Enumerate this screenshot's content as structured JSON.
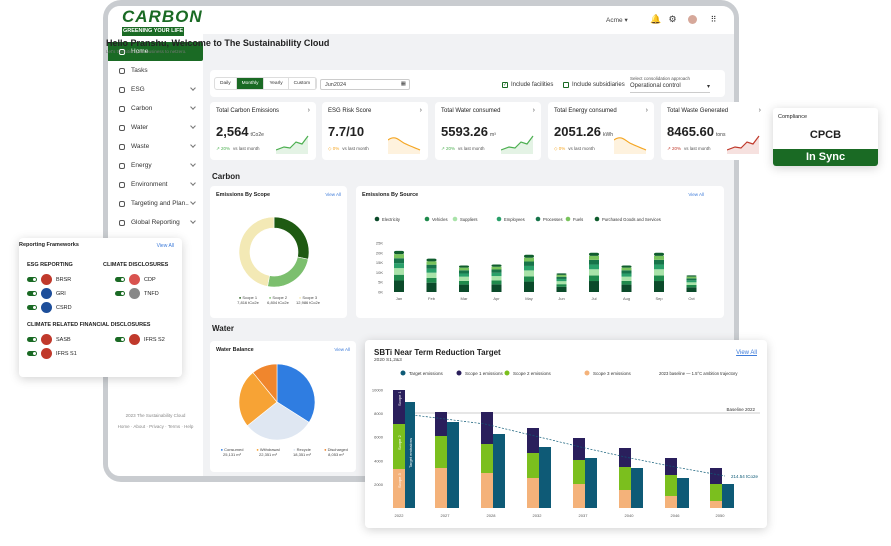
{
  "brand": {
    "logo_word": "CARBON",
    "logo_tagline": "GREENING YOUR LIFE"
  },
  "sidebar": {
    "items": [
      {
        "label": "Home",
        "active": true
      },
      {
        "label": "Tasks"
      },
      {
        "label": "ESG",
        "chevron": true
      },
      {
        "label": "Carbon",
        "chevron": true
      },
      {
        "label": "Water",
        "chevron": true
      },
      {
        "label": "Waste",
        "chevron": true
      },
      {
        "label": "Energy",
        "chevron": true
      },
      {
        "label": "Environment",
        "chevron": true
      },
      {
        "label": "Targeting and Plan..",
        "chevron": true
      },
      {
        "label": "Global Reporting",
        "chevron": true
      }
    ],
    "footer_copyright": "2023 The Sustainability Cloud",
    "footer_links": "Home · About · Privacy · Terms · Help"
  },
  "topbar": {
    "org": "Acme"
  },
  "welcome": {
    "title": "Hello Pranshu, Welcome to The Sustainability Cloud",
    "subtitle": "Let's transition your business to netzero."
  },
  "filters": {
    "periods": [
      "Daily",
      "Monthly",
      "Yearly",
      "Custom"
    ],
    "active_period": "Monthly",
    "date": "Jun2024",
    "include_facilities": "Include facilities",
    "include_subsidiaries": "Include subsidiaries",
    "consolidation_label": "Select consolidation approach",
    "consolidation_value": "Operational control"
  },
  "kpis": [
    {
      "title": "Total Carbon Emissions",
      "value": "2,564",
      "unit": "tCo2e",
      "delta": "20%",
      "delta_text": "vs last month",
      "trend": "up",
      "color": "#4caf50"
    },
    {
      "title": "ESG Risk Score",
      "value": "7.7/10",
      "unit": "",
      "delta": "0%",
      "delta_text": "vs last month",
      "trend": "flat",
      "color": "#f5a623"
    },
    {
      "title": "Total Water consumed",
      "value": "5593.26",
      "unit": "m³",
      "delta": "20%",
      "delta_text": "vs last month",
      "trend": "up",
      "color": "#4caf50"
    },
    {
      "title": "Total Energy consumed",
      "value": "2051.26",
      "unit": "kWh",
      "delta": "0%",
      "delta_text": "vs last month",
      "trend": "flat",
      "color": "#f5a623"
    },
    {
      "title": "Total Waste Generated",
      "value": "8465.60",
      "unit": "tons",
      "delta": "20%",
      "delta_text": "vs last month",
      "trend": "up",
      "color": "#c0392b"
    }
  ],
  "compliance": {
    "title": "Compliance",
    "name": "CPCB",
    "status": "In Sync"
  },
  "sections": {
    "carbon": "Carbon",
    "water": "Water"
  },
  "view_all": "View All",
  "emissions_scope": {
    "title": "Emissions By Scope",
    "legend": [
      {
        "name": "Scope 1",
        "value": "7,816",
        "unit": "tCo2e"
      },
      {
        "name": "Scope 2",
        "value": "6,804",
        "unit": "tCo2e"
      },
      {
        "name": "Scope 3",
        "value": "12,986",
        "unit": "tCo2e"
      }
    ]
  },
  "water_balance": {
    "title": "Water Balance",
    "legend": [
      {
        "name": "Consumed",
        "value": "25,131",
        "unit": "m³"
      },
      {
        "name": "Withdrawal",
        "value": "22,351",
        "unit": "m³"
      },
      {
        "name": "Recycle",
        "value": "18,351",
        "unit": "m³"
      },
      {
        "name": "Discharged",
        "value": "8,053",
        "unit": "m³"
      }
    ]
  },
  "reporting": {
    "title": "Reporting Frameworks",
    "esg_heading": "ESG REPORTING",
    "climate_heading": "CLIMATE DISCLOSURES",
    "tcfd_heading": "CLIMATE RELATED FINANCIAL DISCLOSURES",
    "esg": [
      "BRSR",
      "GRI",
      "CSRD"
    ],
    "climate": [
      "CDP",
      "TNFD"
    ],
    "tcfd": [
      "SASB",
      "IFRS S1",
      "IFRS S2"
    ]
  },
  "chart_data": [
    {
      "type": "pie",
      "title": "Emissions By Scope",
      "categories": [
        "Scope 1",
        "Scope 2",
        "Scope 3"
      ],
      "values": [
        7816,
        6804,
        12986
      ],
      "colors": [
        "#1e5a12",
        "#7cbf6e",
        "#f3e9b5"
      ]
    },
    {
      "type": "pie",
      "title": "Water Balance",
      "categories": [
        "Consumed",
        "Withdrawal",
        "Recycle",
        "Discharged"
      ],
      "values": [
        25131,
        22351,
        18351,
        8053
      ],
      "colors": [
        "#2f7de1",
        "#dfe7f2",
        "#f7a335",
        "#f0862d"
      ]
    },
    {
      "type": "bar",
      "title": "Emissions By Source",
      "categories": [
        "Jan",
        "Feb",
        "Mar",
        "Apr",
        "May",
        "Jun",
        "Jul",
        "Aug",
        "Sep",
        "Oct"
      ],
      "yticks": [
        "25K",
        "20K",
        "15K",
        "10K",
        "5K",
        "0K"
      ],
      "ylim": [
        0,
        25000
      ],
      "totals": [
        21000,
        17000,
        13500,
        14000,
        19000,
        9500,
        20000,
        13500,
        20000,
        8500
      ],
      "series": [
        {
          "name": "Electricity",
          "color": "#0b4a2a"
        },
        {
          "name": "Vehicles",
          "color": "#1f8a4c"
        },
        {
          "name": "Suppliers",
          "color": "#a9e3a9"
        },
        {
          "name": "Employees",
          "color": "#2aa06a"
        },
        {
          "name": "Processes",
          "color": "#17744a"
        },
        {
          "name": "Fuels",
          "color": "#79c35c"
        },
        {
          "name": "Purchased Goods and Services",
          "color": "#0f5d2d"
        }
      ]
    },
    {
      "type": "bar",
      "title": "SBTi Near Term Reduction Target",
      "subtitle": "2020 S1,2&3",
      "categories": [
        "2022",
        "2027",
        "2028",
        "2032",
        "2037",
        "2040",
        "2046",
        "2050"
      ],
      "yticks": [
        "10000",
        "8000",
        "6000",
        "4000",
        "2000"
      ],
      "ylim": [
        0,
        10000
      ],
      "series": [
        {
          "name": "Target emissions",
          "color": "#0e5a76"
        },
        {
          "name": "Scope 1 emissions",
          "color": "#2a1f5c"
        },
        {
          "name": "Scope 2 emissions",
          "color": "#7bbf1e"
        },
        {
          "name": "Scope 3 emissions",
          "color": "#f4b27a"
        }
      ],
      "baseline_label": "Baseline 2022",
      "legend_note": "2023 baseline — 1.5°C ambition trajectory",
      "end_label": "214.54 tCo2e",
      "axis_labels": [
        "Scope 3",
        "Scope 2",
        "Scope 1",
        "Target emissions"
      ]
    }
  ]
}
